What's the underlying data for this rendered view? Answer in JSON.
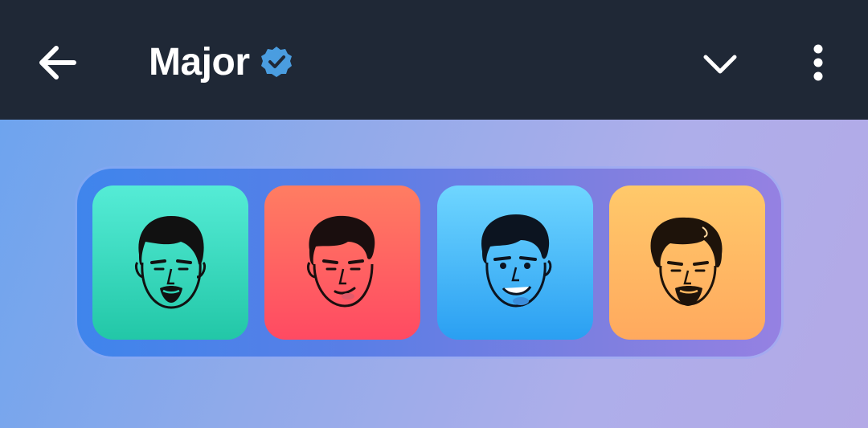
{
  "header": {
    "title": "Major",
    "back_icon": "arrow-left-icon",
    "verified_icon": "verified-badge-icon",
    "expand_icon": "chevron-down-icon",
    "menu_icon": "more-vertical-icon",
    "background_color": "#1f2836",
    "verified_color": "#4a9de0"
  },
  "avatars": [
    {
      "icon": "face-goatee-icon",
      "color": "#2fd3b5"
    },
    {
      "icon": "face-smirk-icon",
      "color": "#ff5e62"
    },
    {
      "icon": "face-smile-icon",
      "color": "#45b3f7"
    },
    {
      "icon": "face-long-hair-icon",
      "color": "#ffb760"
    }
  ]
}
